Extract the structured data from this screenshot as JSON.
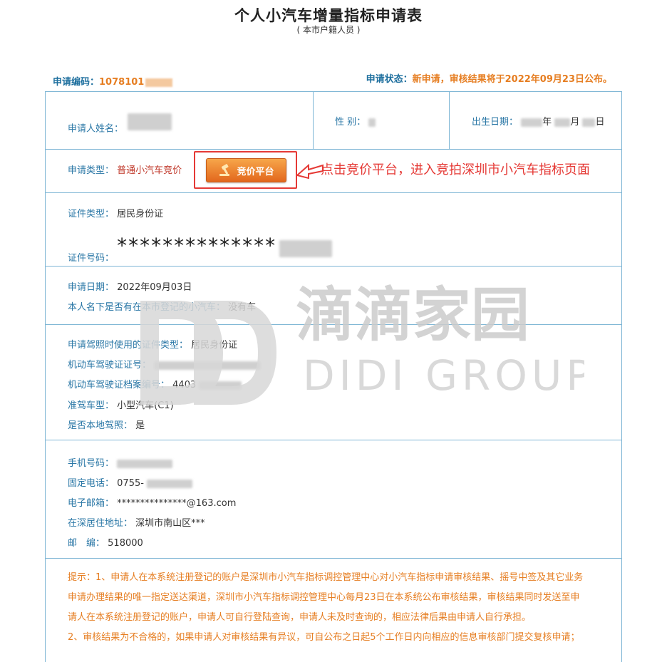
{
  "header": {
    "title": "个人小汽车增量指标申请表",
    "subtitle": "( 本市户籍人员 )"
  },
  "meta": {
    "code_label": "申请编码：",
    "code_value": "1078101",
    "status_label": "申请状态：",
    "status_value": "新申请，审核结果将于2022年09月23日公布。"
  },
  "row1": {
    "name_label": "申请人姓名：",
    "gender_label": "性 别：",
    "birth_label": "出生日期：",
    "birth_year_suffix": "年",
    "birth_month_suffix": "月",
    "birth_day_suffix": "日"
  },
  "row2": {
    "type_label": "申请类型：",
    "type_value": "普通小汽车竞价",
    "bid_button": "竞价平台",
    "annotation": "点击竞价平台，进入竞拍深圳市小汽车指标页面"
  },
  "row3": {
    "id_type_label": "证件类型：",
    "id_type_value": "居民身份证",
    "id_no_label": "证件号码：",
    "id_no_value": "**************"
  },
  "row4": {
    "date_label": "申请日期：",
    "date_value": "2022年09月03日",
    "car_label": "本人名下是否有在本市登记的小汽车：",
    "car_value": "没有车"
  },
  "row5": {
    "license_id_type_label": "申请驾照时使用的证件类型：",
    "license_id_type_value": "居民身份证",
    "license_no_label": "机动车驾驶证证号：",
    "archive_no_label": "机动车驾驶证档案编号：",
    "archive_no_value": "4403",
    "vehicle_type_label": "准驾车型：",
    "vehicle_type_value": "小型汽车(C1)",
    "local_label": "是否本地驾照：",
    "local_value": "是"
  },
  "row6": {
    "mobile_label": "手机号码：",
    "phone_label": "固定电话：",
    "phone_value": "0755-",
    "email_label": "电子邮箱：",
    "email_value": "***************@163.com",
    "address_label": "在深居住地址：",
    "address_value": "深圳市南山区***",
    "postcode_label": "邮　编：",
    "postcode_value": "518000"
  },
  "notice": {
    "line1": "提示：1、申请人在本系统注册登记的账户是深圳市小汽车指标调控管理中心对小汽车指标申请审核结果、摇号中签及其它业务",
    "line2": "申请办理结果的唯一指定送达渠道，深圳市小汽车指标调控管理中心每月23日在本系统公布审核结果，审核结果同时发送至申",
    "line3": "请人在本系统注册登记的账户，申请人可自行登陆查询，申请人未及时查询的，相应法律后果由申请人自行承担。",
    "line4": "2、审核结果为不合格的，如果申请人对审核结果有异议，可自公布之日起5个工作日内向相应的信息审核部门提交复核申请；"
  },
  "watermark": {
    "cn": "滴滴家园",
    "en": "DIDI GROUP"
  }
}
